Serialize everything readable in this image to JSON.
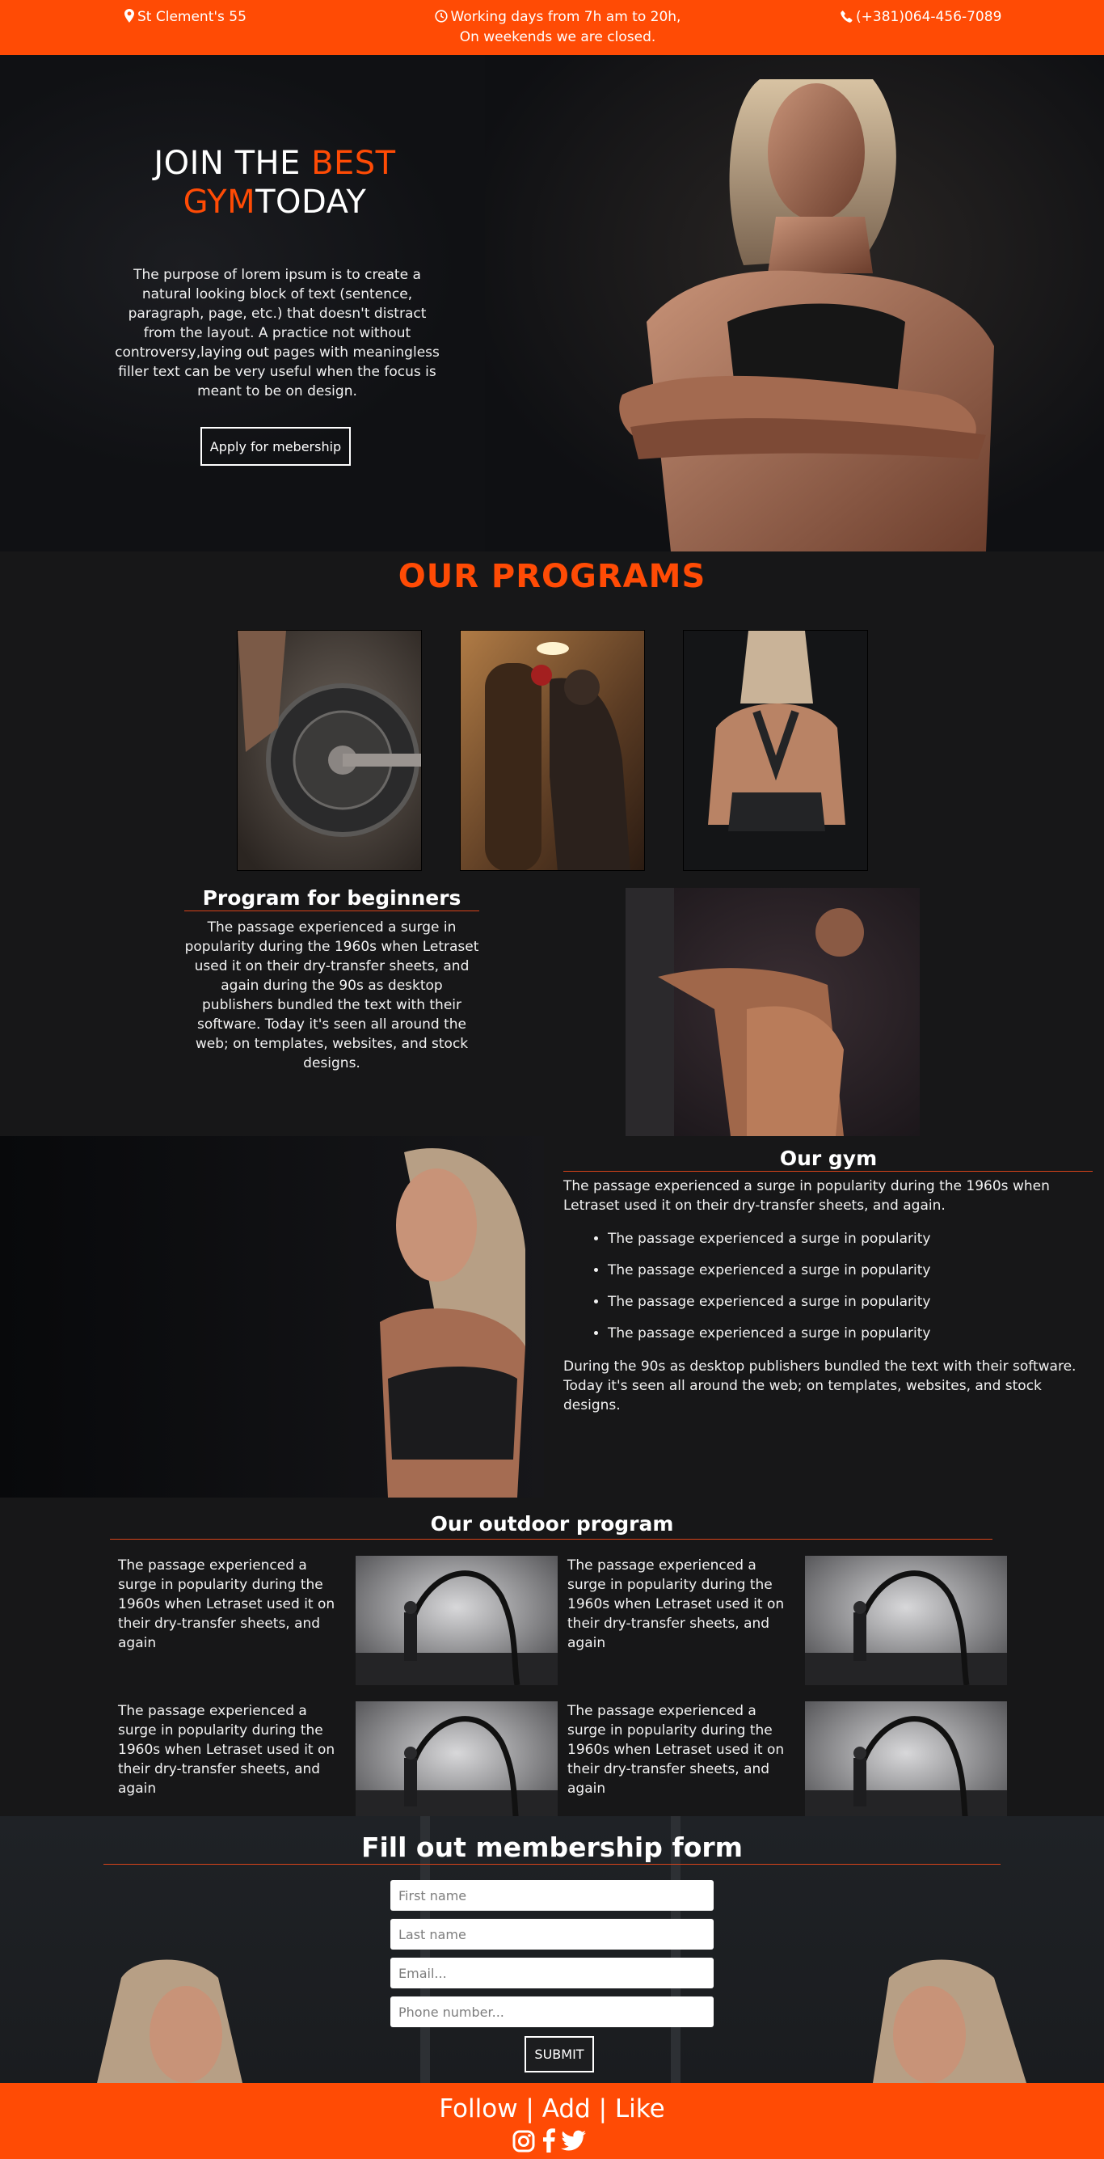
{
  "topbar": {
    "address": "St Clement's 55",
    "hours_line1": "Working days from 7h am to 20h,",
    "hours_line2": "On weekends we are closed.",
    "phone": "(+381)064-456-7089"
  },
  "hero": {
    "title_join": "JOIN THE ",
    "title_best": "BEST",
    "title_gym": "GYM",
    "title_today": "TODAY",
    "text": "The purpose of lorem ipsum is to create a natural looking block of text (sentence, paragraph, page, etc.) that doesn't distract from the layout. A practice not without controversy,laying out pages with meaningless filler text can be very useful when the focus is meant to be on design.",
    "button_label": "Apply for mebership"
  },
  "programs": {
    "title": "OUR PROGRAMS",
    "beginners_title": "Program for beginners",
    "beginners_text": "The passage experienced a surge in popularity during the 1960s when Letraset used it on their dry-transfer sheets, and again during the 90s as desktop publishers bundled the text with their software. Today it's seen all around the web; on templates, websites, and stock designs."
  },
  "gym": {
    "title": "Our gym",
    "intro": "The passage experienced a surge in popularity during the 1960s when Letraset used it on their dry-transfer sheets, and again.",
    "list": [
      "The passage experienced a surge in popularity",
      "The passage experienced a surge in popularity",
      "The passage experienced a surge in popularity",
      "The passage experienced a surge in popularity"
    ],
    "outro": "During the 90s as desktop publishers bundled the text with their software. Today it's seen all around the web; on templates, websites, and stock designs."
  },
  "outdoor": {
    "title": "Our outdoor program",
    "items": [
      "The passage experienced a surge in popularity during the 1960s when Letraset used it on their dry-transfer sheets, and again",
      "The passage experienced a surge in popularity during the 1960s when Letraset used it on their dry-transfer sheets, and again",
      "The passage experienced a surge in popularity during the 1960s when Letraset used it on their dry-transfer sheets, and again",
      "The passage experienced a surge in popularity during the 1960s when Letraset used it on their dry-transfer sheets, and again"
    ]
  },
  "form": {
    "title": "Fill out membership form",
    "first_name_placeholder": "First name",
    "last_name_placeholder": "Last name",
    "email_placeholder": "Email...",
    "phone_placeholder": "Phone number...",
    "submit_label": "SUBMIT"
  },
  "footer": {
    "text": "Follow | Add | Like",
    "icons": [
      "instagram-icon",
      "facebook-icon",
      "twitter-icon"
    ]
  },
  "colors": {
    "accent": "#ff4b05",
    "background": "#171718"
  }
}
